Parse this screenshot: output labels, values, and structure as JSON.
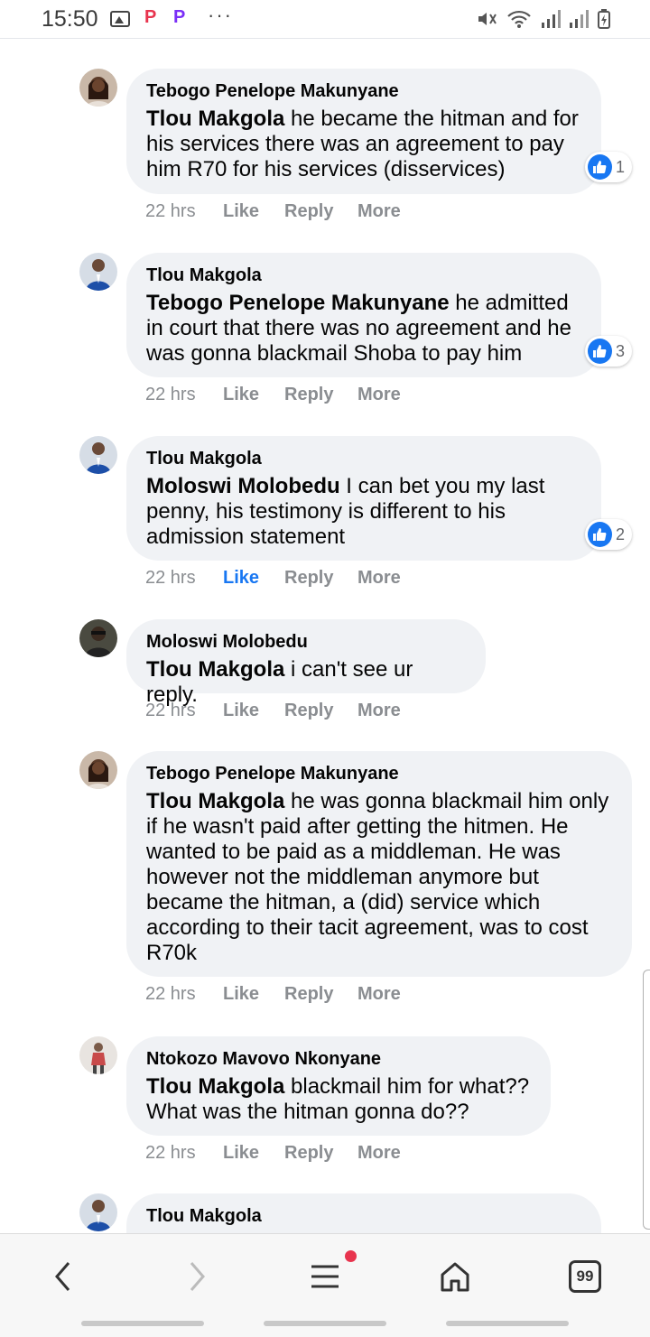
{
  "status_bar": {
    "time": "15:50",
    "icons": [
      "gallery-icon",
      "p-app-icon",
      "p-app-icon",
      "more-dots-icon",
      "mute-icon",
      "wifi-icon",
      "signal-icon",
      "signal-icon",
      "battery-charging-icon"
    ],
    "p_letter": "P",
    "dots": "···"
  },
  "comments": [
    {
      "author": "Tebogo Penelope Makunyane",
      "mention": "Tlou Makgola",
      "text": " he became the hitman and for his services there was an agreement to pay him R70 for his services (disservices)",
      "time": "22 hrs",
      "like": "Like",
      "reply": "Reply",
      "more": "More",
      "liked_by_me": false,
      "reactions": "1"
    },
    {
      "author": "Tlou Makgola",
      "mention": "Tebogo Penelope Makunyane",
      "text": " he admitted in court that there was no agreement and he was gonna blackmail Shoba to pay him",
      "time": "22 hrs",
      "like": "Like",
      "reply": "Reply",
      "more": "More",
      "liked_by_me": false,
      "reactions": "3"
    },
    {
      "author": "Tlou Makgola",
      "mention": "Moloswi Molobedu",
      "text": " I can bet you my last penny, his testimony is different to his admission statement",
      "time": "22 hrs",
      "like": "Like",
      "reply": "Reply",
      "more": "More",
      "liked_by_me": true,
      "reactions": "2"
    },
    {
      "author": "Moloswi Molobedu",
      "mention": "Tlou Makgola",
      "text": " i can't see ur reply.",
      "time": "22 hrs",
      "like": "Like",
      "reply": "Reply",
      "more": "More",
      "liked_by_me": false,
      "reactions": null
    },
    {
      "author": "Tebogo Penelope Makunyane",
      "mention": "Tlou Makgola",
      "text": " he was gonna blackmail him only if he wasn't paid after getting the hitmen. He wanted to be paid as a middleman. He was however not the middleman anymore but became the hitman, a (did) service which according to their tacit agreement, was to cost R70k",
      "time": "22 hrs",
      "like": "Like",
      "reply": "Reply",
      "more": "More",
      "liked_by_me": false,
      "reactions": null
    },
    {
      "author": "Ntokozo Mavovo Nkonyane",
      "mention": "Tlou Makgola",
      "text": " blackmail him for what?? What was the hitman gonna do??",
      "time": "22 hrs",
      "like": "Like",
      "reply": "Reply",
      "more": "More",
      "liked_by_me": false,
      "reactions": null
    },
    {
      "author": "Tlou Makgola",
      "mention": "",
      "text": "",
      "time": "",
      "like": "",
      "reply": "",
      "more": "",
      "liked_by_me": false,
      "reactions": null
    }
  ],
  "bottom_nav": {
    "tabs_count": "99",
    "icons": [
      "back-arrow-icon",
      "forward-arrow-icon",
      "menu-icon",
      "home-icon",
      "tabs-icon"
    ],
    "colors": {
      "accent": "#1877f2",
      "notification": "#e8344e"
    }
  }
}
